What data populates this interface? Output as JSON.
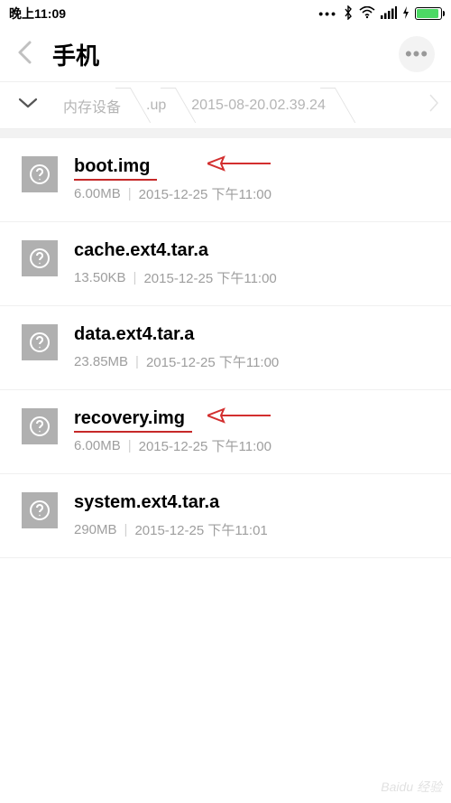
{
  "status": {
    "time": "晚上11:09"
  },
  "header": {
    "title": "手机"
  },
  "breadcrumb": {
    "items": [
      "内存设备",
      ".up",
      "2015-08-20.02.39.24"
    ]
  },
  "files": [
    {
      "name": "boot.img",
      "size": "6.00MB",
      "date": "2015-12-25 下午11:00",
      "underlined": true,
      "arrow": true
    },
    {
      "name": "cache.ext4.tar.a",
      "size": "13.50KB",
      "date": "2015-12-25 下午11:00",
      "underlined": false,
      "arrow": false
    },
    {
      "name": "data.ext4.tar.a",
      "size": "23.85MB",
      "date": "2015-12-25 下午11:00",
      "underlined": false,
      "arrow": false
    },
    {
      "name": "recovery.img",
      "size": "6.00MB",
      "date": "2015-12-25 下午11:00",
      "underlined": true,
      "arrow": true
    },
    {
      "name": "system.ext4.tar.a",
      "size": "290MB",
      "date": "2015-12-25 下午11:01",
      "underlined": false,
      "arrow": false
    }
  ],
  "watermark": "Baidu 经验"
}
